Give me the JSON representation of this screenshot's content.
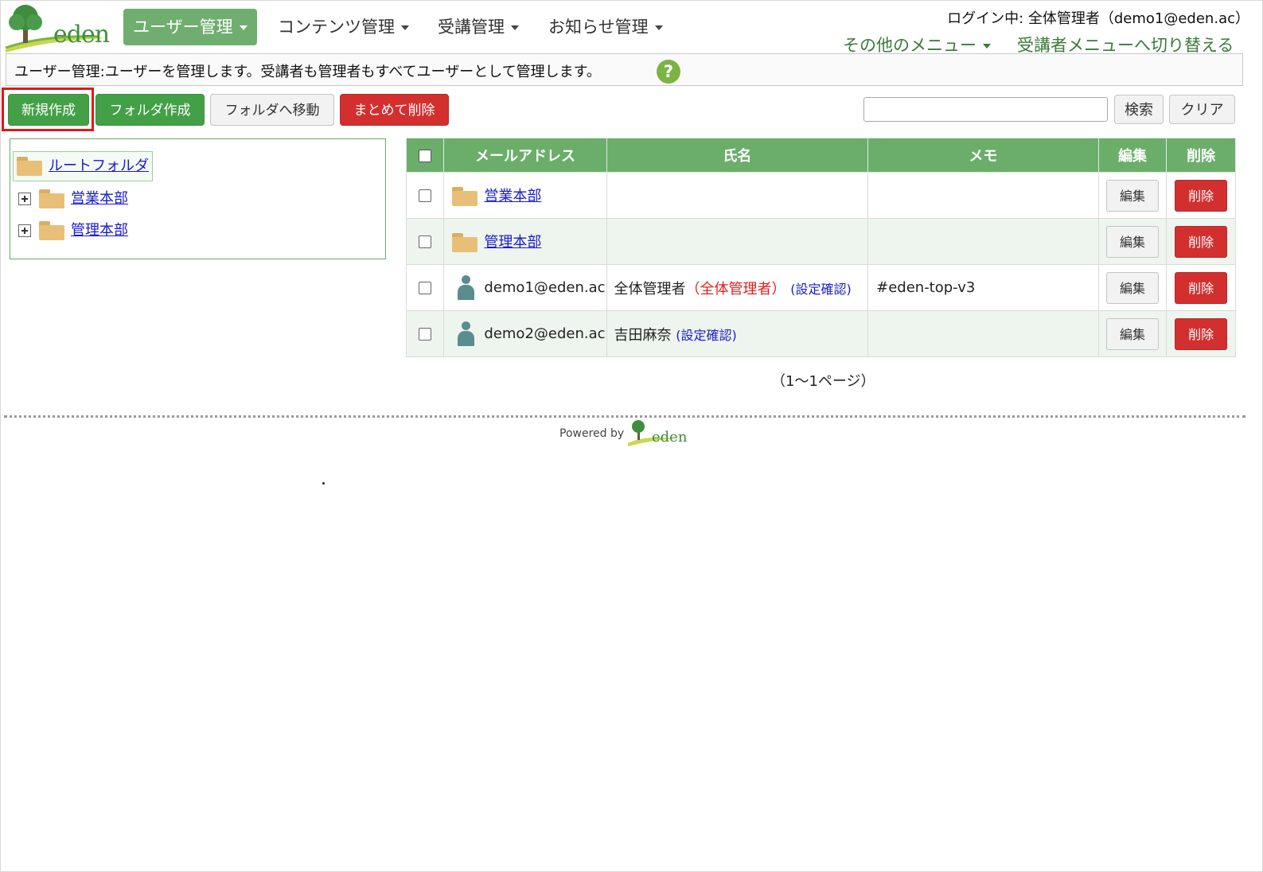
{
  "brand": {
    "logo_text": "eden"
  },
  "nav": {
    "items": [
      {
        "label": "ユーザー管理",
        "active": true
      },
      {
        "label": "コンテンツ管理",
        "active": false
      },
      {
        "label": "受講管理",
        "active": false
      },
      {
        "label": "お知らせ管理",
        "active": false
      }
    ],
    "login_info": "ログイン中: 全体管理者（demo1@eden.ac）",
    "other_menu": "その他のメニュー",
    "switch_menu": "受講者メニューへ切り替える"
  },
  "description": "ユーザー管理:ユーザーを管理します。受講者も管理者もすべてユーザーとして管理します。",
  "help_icon": "?",
  "toolbar": {
    "new_label": "新規作成",
    "folder_create_label": "フォルダ作成",
    "folder_move_label": "フォルダへ移動",
    "bulk_delete_label": "まとめて削除",
    "search_value": "",
    "search_label": "検索",
    "clear_label": "クリア"
  },
  "tree": {
    "root": "ルートフォルダ",
    "folders": [
      "営業本部",
      "管理本部"
    ]
  },
  "table": {
    "headers": [
      "メールアドレス",
      "氏名",
      "メモ",
      "編集",
      "削除"
    ],
    "rows": [
      {
        "type": "folder",
        "email": "営業本部",
        "name": "",
        "role": "",
        "settings": "",
        "memo": "",
        "edit": "編集",
        "delete": "削除"
      },
      {
        "type": "folder",
        "email": "管理本部",
        "name": "",
        "role": "",
        "settings": "",
        "memo": "",
        "edit": "編集",
        "delete": "削除"
      },
      {
        "type": "user",
        "email": "demo1@eden.ac",
        "name": "全体管理者",
        "role": "（全体管理者）",
        "settings": "(設定確認)",
        "memo": "#eden-top-v3",
        "edit": "編集",
        "delete": "削除"
      },
      {
        "type": "user",
        "email": "demo2@eden.ac",
        "name": "吉田麻奈",
        "role": "",
        "settings": "(設定確認)",
        "memo": "",
        "edit": "編集",
        "delete": "削除"
      }
    ]
  },
  "pager": "（1～1ページ）",
  "footer": {
    "powered_by": "Powered by",
    "logo_text": "eden"
  },
  "colors": {
    "accent_green": "#6aae6a",
    "button_green": "#43a047",
    "button_red": "#d32f2f",
    "link_blue": "#1a1acc",
    "highlight_red": "#e01818"
  }
}
